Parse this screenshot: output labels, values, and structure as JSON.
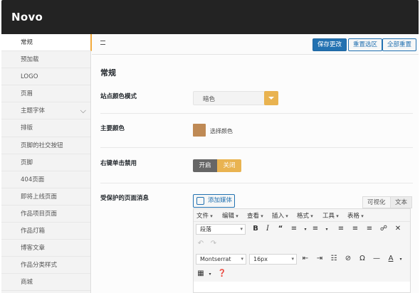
{
  "app": {
    "brand": "Novo"
  },
  "sidebar": {
    "items": [
      {
        "label": "常规",
        "active": true
      },
      {
        "label": "预加载"
      },
      {
        "label": "LOGO"
      },
      {
        "label": "页眉"
      },
      {
        "label": "主题字体",
        "has_chevron": true
      },
      {
        "label": "排版"
      },
      {
        "label": "页脚的社交按钮"
      },
      {
        "label": "页脚"
      },
      {
        "label": "404页面"
      },
      {
        "label": "即将上线页面"
      },
      {
        "label": "作品项目页面"
      },
      {
        "label": "作品灯箱"
      },
      {
        "label": "博客文章"
      },
      {
        "label": "作品分类样式"
      },
      {
        "label": "商城"
      }
    ]
  },
  "toolbar": {
    "save_label": "保存更改",
    "reset_section_label": "重置选区",
    "reset_all_label": "全部重置"
  },
  "section": {
    "title": "常规"
  },
  "fields": {
    "color_mode": {
      "label": "站点颜色模式",
      "value": "暗色"
    },
    "main_color": {
      "label": "主要颜色",
      "link": "选择颜色",
      "color": "#bf8a55"
    },
    "right_click": {
      "label": "右键单击禁用",
      "on_label": "开启",
      "off_label": "关闭"
    },
    "protected_msg": {
      "label": "受保护的页面消息",
      "add_media": "添加媒体",
      "tab_visual": "可视化",
      "tab_text": "文本"
    }
  },
  "editor": {
    "menus": [
      "文件",
      "编辑",
      "查看",
      "插入",
      "格式",
      "工具",
      "表格"
    ],
    "format_select": "段落",
    "font_select": "Montserrat",
    "size_select": "16px"
  },
  "colors": {
    "accent": "#e9b350",
    "primary": "#2271b1",
    "topbar": "#232323"
  }
}
